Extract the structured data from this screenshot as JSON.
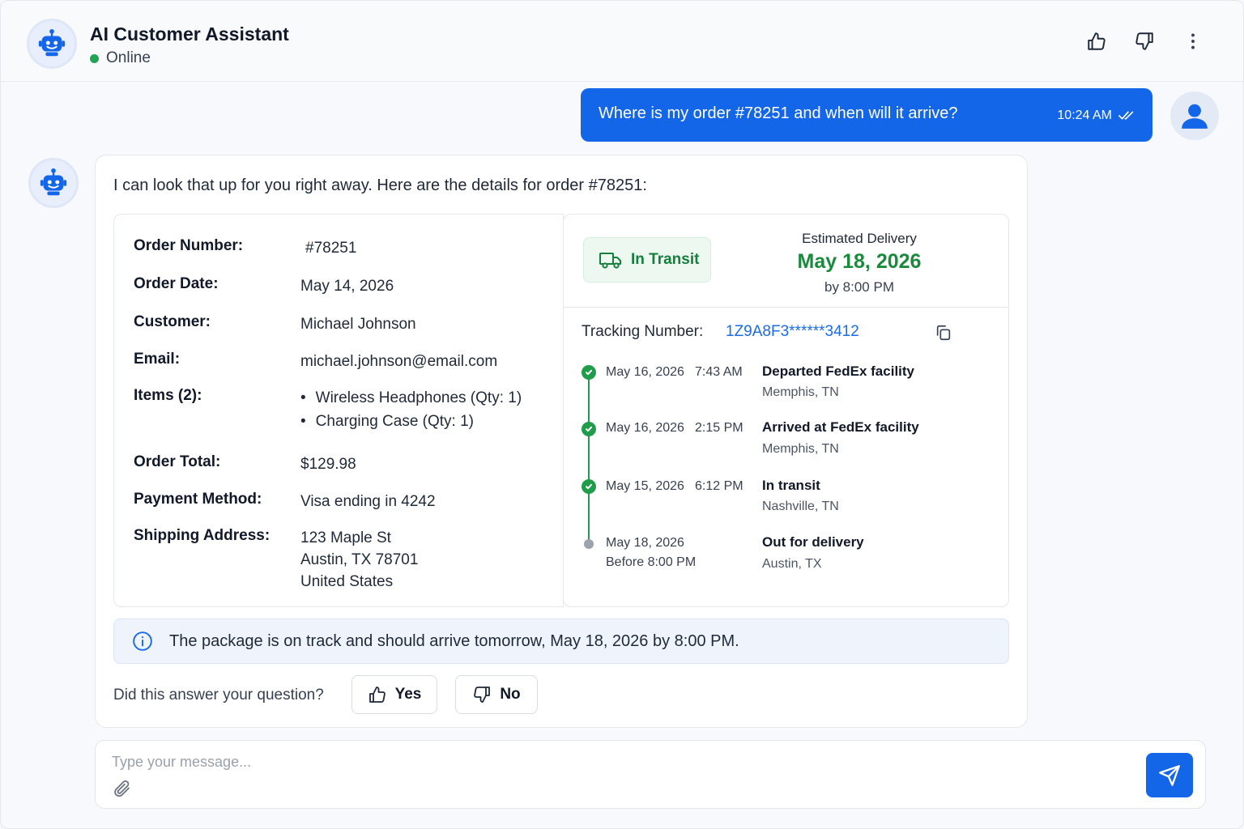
{
  "header": {
    "title": "AI Customer Assistant",
    "status": "Online",
    "icons": [
      "thumbs-up-icon",
      "thumbs-down-icon",
      "more-vertical-icon"
    ]
  },
  "user_message": {
    "text": "Where is my order #78251 and when will it arrive?",
    "time": "10:24 AM"
  },
  "bot_message": {
    "intro": "I can look that up for you right away. Here are the details for order #78251:",
    "order": {
      "number_label": "Order Number:",
      "number": "#78251",
      "date_label": "Order Date:",
      "date": "May 14, 2026",
      "customer_label": "Customer:",
      "customer": "Michael Johnson",
      "email_label": "Email:",
      "email": "michael.johnson@email.com",
      "items_label": "Items (2):",
      "items": [
        "Wireless Headphones (Qty: 1)",
        "Charging Case (Qty: 1)"
      ],
      "total_label": "Order Total:",
      "total": "$129.98",
      "payment_label": "Payment Method:",
      "payment": "Visa ending in 4242",
      "address_label": "Shipping Address:",
      "address": [
        "123 Maple St",
        "Austin, TX 78701",
        "United States"
      ]
    },
    "tracking": {
      "status": "In Transit",
      "est_label": "Estimated Delivery",
      "est_date": "May 18, 2026",
      "est_by": "by 8:00 PM",
      "number_label": "Tracking Number:",
      "number": "1Z9A8F3******3412",
      "events": [
        {
          "date": "May 16, 2026",
          "time": "7:43 AM",
          "title": "Departed FedEx facility",
          "location": "Memphis, TN",
          "done": true
        },
        {
          "date": "May 16, 2026",
          "time": "2:15 PM",
          "title": "Arrived at FedEx facility",
          "location": "Memphis, TN",
          "done": true
        },
        {
          "date": "May 15, 2026",
          "time": "6:12 PM",
          "title": "In transit",
          "location": "Nashville, TN",
          "done": true
        },
        {
          "date": "May 18, 2026",
          "time": "Before 8:00 PM",
          "title": "Out for delivery",
          "location": "Austin, TX",
          "done": false
        }
      ]
    },
    "info": "The package is on track and should arrive tomorrow, May 18, 2026 by 8:00 PM.",
    "feedback": {
      "question": "Did this answer your question?",
      "yes": "Yes",
      "no": "No"
    }
  },
  "composer": {
    "placeholder": "Type your message..."
  },
  "colors": {
    "primary": "#1466e8",
    "success": "#1a8a3c",
    "online": "#22a355"
  }
}
